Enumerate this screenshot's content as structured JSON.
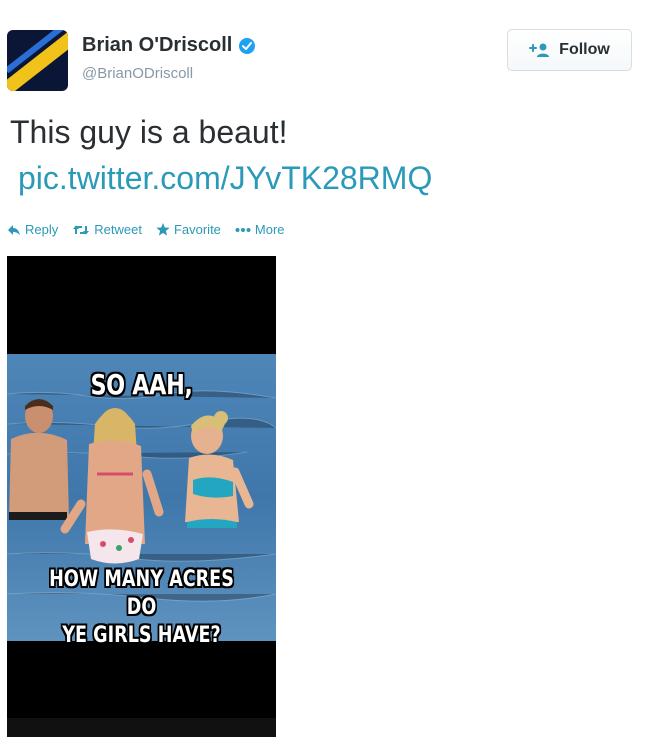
{
  "user": {
    "name": "Brian O'Driscoll",
    "handle": "@BrianODriscoll",
    "verified_icon": "verified-badge-icon",
    "avatar_colors": {
      "bg": "#0b1636",
      "stripe": "#f0c21a",
      "stripe2": "#2a6fd6"
    }
  },
  "follow_button": {
    "label": "Follow",
    "icon": "add-user-icon"
  },
  "tweet": {
    "text": "This guy is a beaut!",
    "link": "pic.twitter.com/JYvTK28RMQ"
  },
  "actions": [
    {
      "label": "Reply",
      "icon": "reply-icon"
    },
    {
      "label": "Retweet",
      "icon": "retweet-icon"
    },
    {
      "label": "Favorite",
      "icon": "star-icon"
    },
    {
      "label": "More",
      "icon": "more-dots-icon"
    }
  ],
  "media": {
    "caption_top": "SO AAH,",
    "caption_bottom_line1": "HOW MANY ACRES DO",
    "caption_bottom_line2": "YE GIRLS HAVE?"
  },
  "colors": {
    "link": "#2a9ab8",
    "text": "#292f33",
    "muted": "#8899a6",
    "verified": "#1da1f2"
  }
}
